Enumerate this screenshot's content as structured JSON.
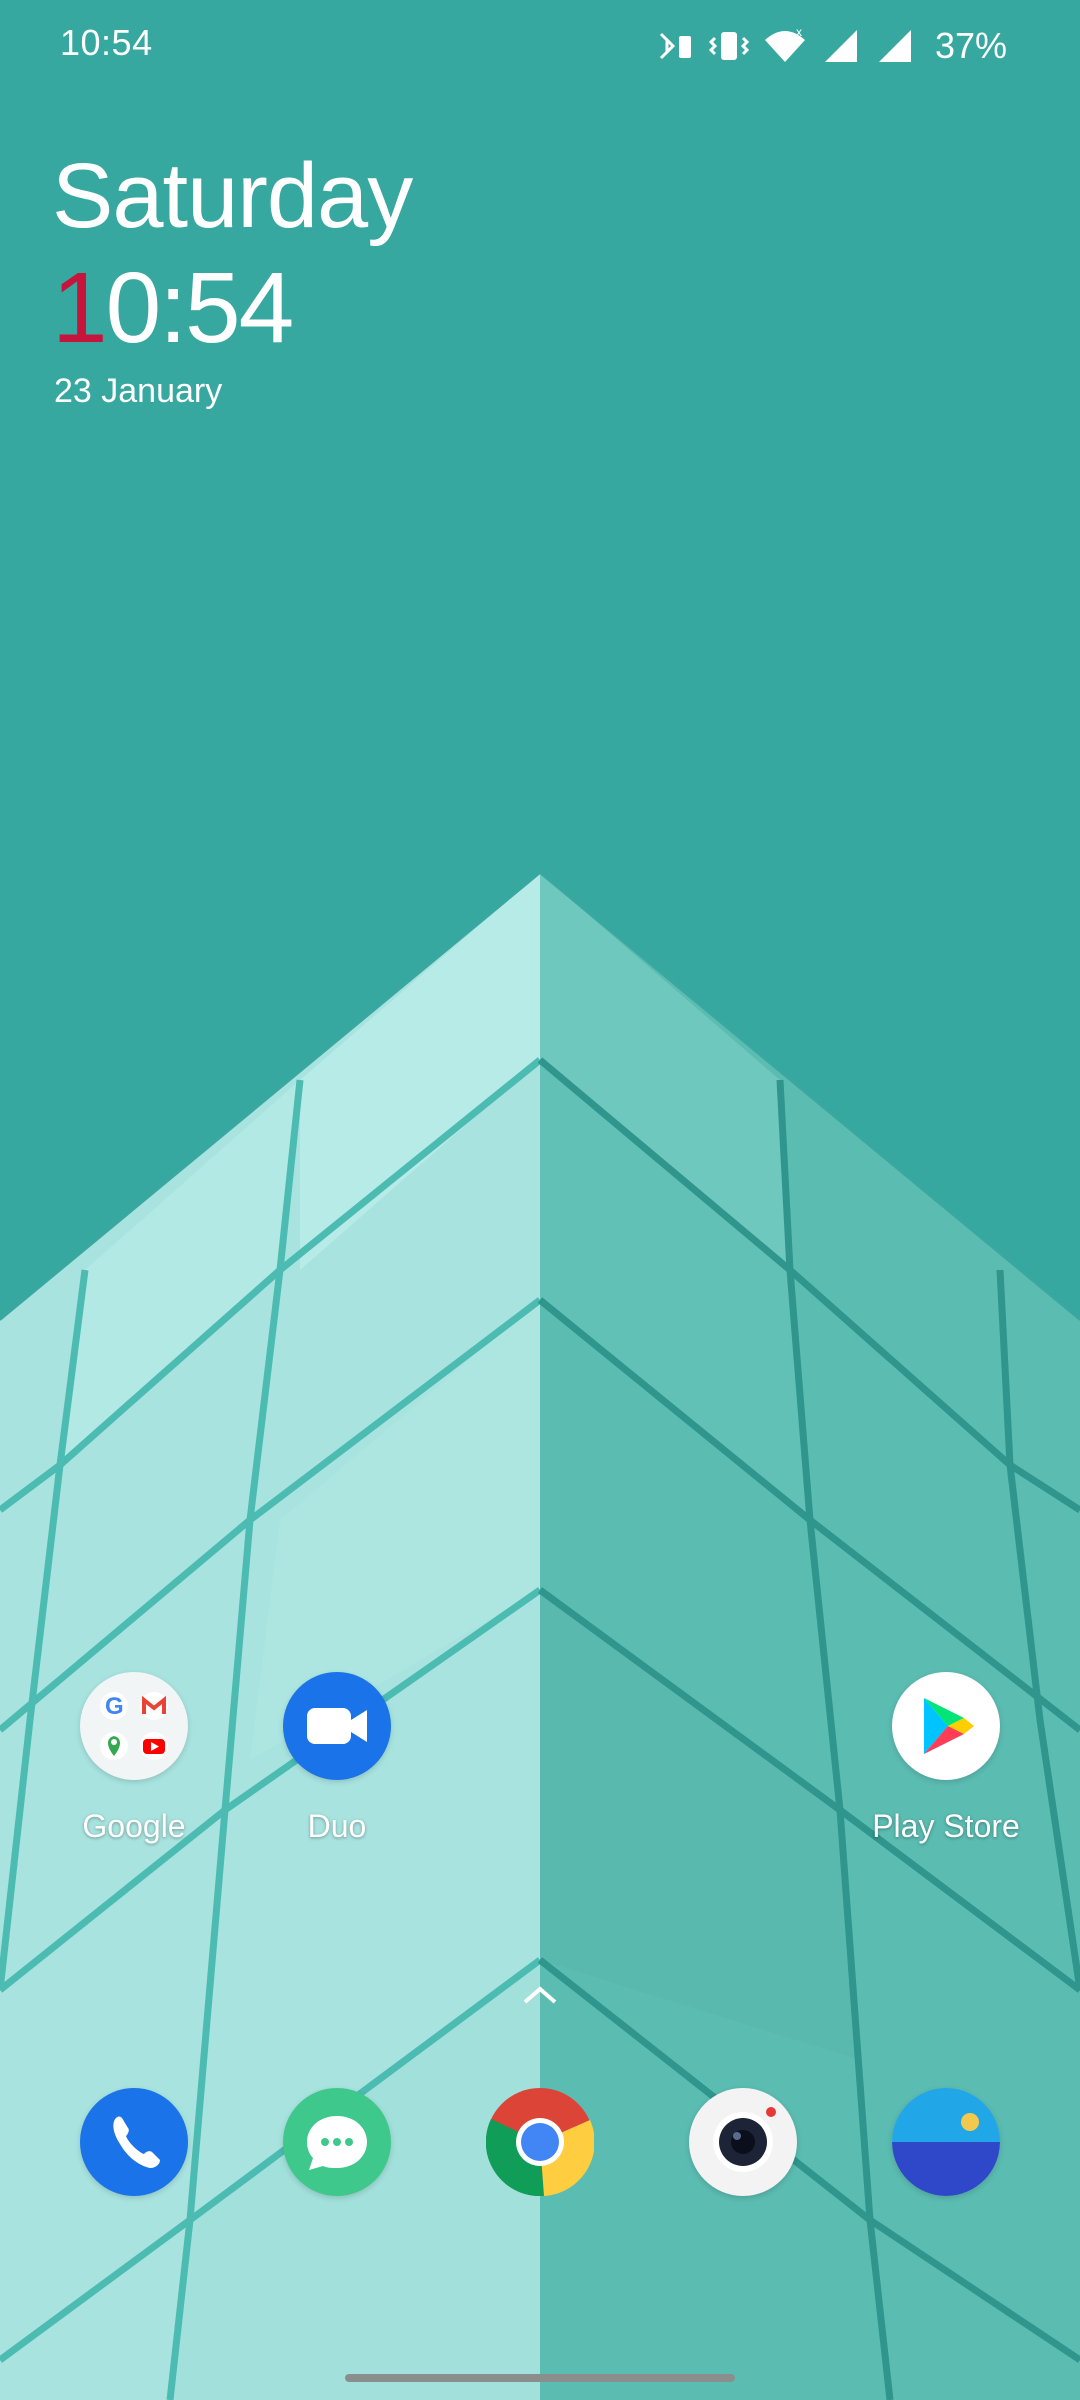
{
  "status_bar": {
    "time": "10:54",
    "battery": "37%",
    "icons": [
      "bluetooth-battery-icon",
      "vibrate-icon",
      "wifi-icon",
      "signal-icon",
      "signal-icon"
    ]
  },
  "clock": {
    "day": "Saturday",
    "time_accent": "1",
    "time_rest": "0:54",
    "date": "23 January",
    "accent_color": "#c7143c"
  },
  "home_apps": [
    {
      "label": "Google",
      "icon": "google-folder-icon"
    },
    {
      "label": "Duo",
      "icon": "duo-icon"
    },
    {
      "label": "Play Store",
      "icon": "play-store-icon"
    }
  ],
  "dock": [
    {
      "icon": "phone-icon"
    },
    {
      "icon": "messages-icon"
    },
    {
      "icon": "chrome-icon"
    },
    {
      "icon": "camera-icon"
    },
    {
      "icon": "gallery-icon"
    }
  ],
  "colors": {
    "wallpaper_bg": "#37a8a0",
    "duo_blue": "#1a73e8",
    "phone_blue": "#1a73e8",
    "messages_green": "#3fc88c"
  }
}
